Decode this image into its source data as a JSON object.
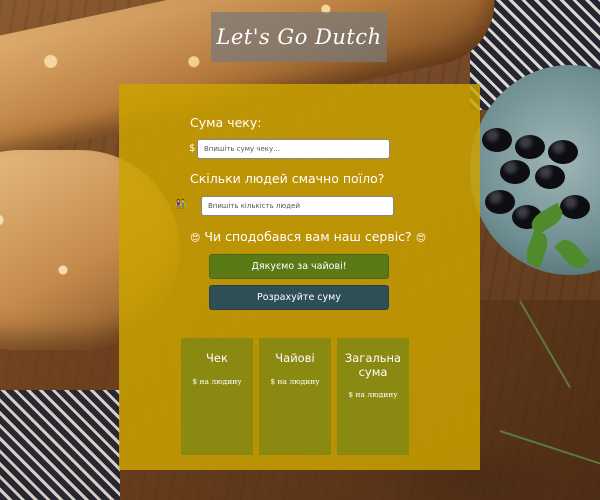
{
  "app": {
    "logo_text": "Let's Go Dutch"
  },
  "form": {
    "bill_label": "Сума чеку:",
    "bill_prefix": "$",
    "bill_placeholder": "Впишіть суму чеку...",
    "people_label": "Скільки людей смачно поїло?",
    "people_prefix": "👫",
    "people_placeholder": "Впишіть кількість людей",
    "service_label": "Чи сподобався вам наш сервіс?",
    "service_emoji_left": "😍",
    "service_emoji_right": "😍"
  },
  "buttons": {
    "tip_label": "Дякуємо за чайові!",
    "calculate_label": "Розрахуйте суму"
  },
  "results": [
    {
      "title": "Чек",
      "value": "$ на людину"
    },
    {
      "title": "Чайові",
      "value": "$ на людину"
    },
    {
      "title": "Загальна сума",
      "value": "$ на людину"
    }
  ],
  "colors": {
    "panel": "#cca300",
    "tip_button": "#5a7a18",
    "calculate_button": "#2f4f57",
    "result_card": "#8a8a12"
  }
}
